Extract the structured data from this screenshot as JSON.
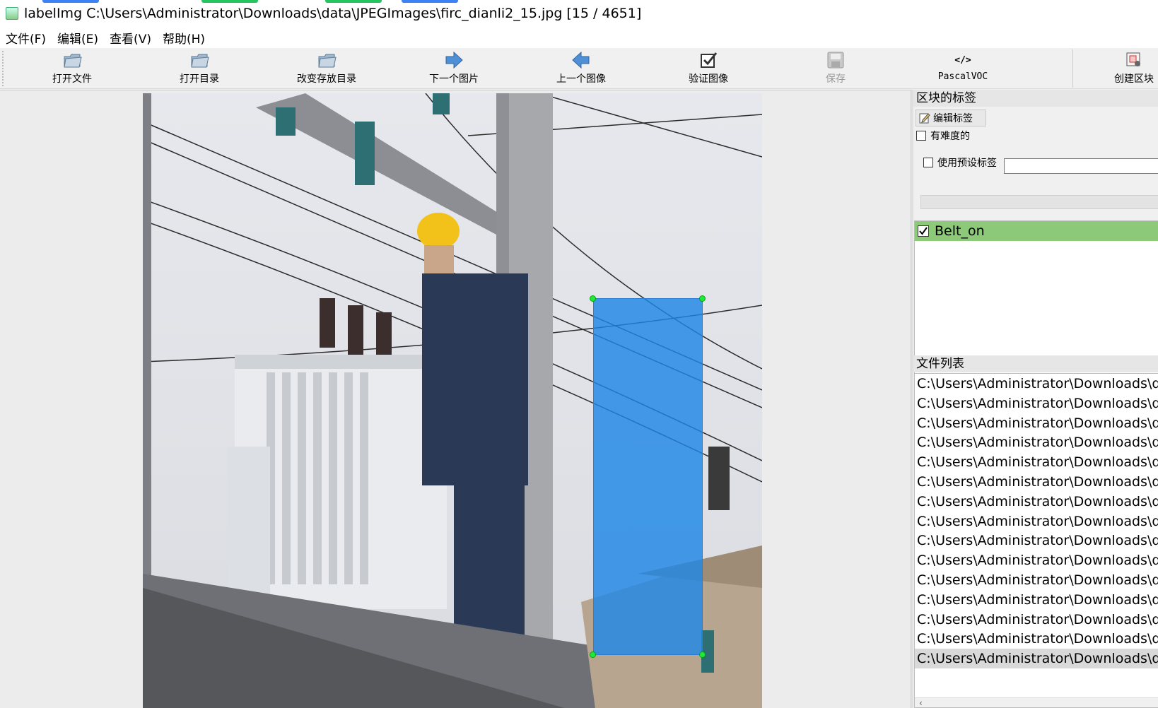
{
  "window": {
    "title": "labelImg C:\\Users\\Administrator\\Downloads\\data\\JPEGImages\\firc_dianli2_15.jpg [15 / 4651]"
  },
  "menu": [
    "文件(F)",
    "编辑(E)",
    "查看(V)",
    "帮助(H)"
  ],
  "toolbar": {
    "open_file": "打开文件",
    "open_dir": "打开目录",
    "change_save_dir": "改变存放目录",
    "next_image": "下一个图片",
    "prev_image": "上一个图像",
    "verify_image": "验证图像",
    "save": "保存",
    "format": "PascalVOC",
    "create_box": "创建区块",
    "format_icon_text": "</>"
  },
  "labels_panel": {
    "title": "区块的标签",
    "edit_label_button": "编辑标签",
    "difficult_label": "有难度的",
    "difficult_checked": false,
    "use_default_label": "使用预设标签",
    "use_default_checked": false,
    "default_label_value": "",
    "items": [
      {
        "label": "Belt_on",
        "checked": true,
        "color": "#8cca7a"
      }
    ]
  },
  "file_panel": {
    "title": "文件列表",
    "files": [
      "C:\\Users\\Administrator\\Downloads\\data",
      "C:\\Users\\Administrator\\Downloads\\data",
      "C:\\Users\\Administrator\\Downloads\\data",
      "C:\\Users\\Administrator\\Downloads\\data",
      "C:\\Users\\Administrator\\Downloads\\data",
      "C:\\Users\\Administrator\\Downloads\\data",
      "C:\\Users\\Administrator\\Downloads\\data",
      "C:\\Users\\Administrator\\Downloads\\data",
      "C:\\Users\\Administrator\\Downloads\\data",
      "C:\\Users\\Administrator\\Downloads\\data",
      "C:\\Users\\Administrator\\Downloads\\data",
      "C:\\Users\\Administrator\\Downloads\\data",
      "C:\\Users\\Administrator\\Downloads\\data",
      "C:\\Users\\Administrator\\Downloads\\data",
      "C:\\Users\\Administrator\\Downloads\\data"
    ],
    "selected_index": 14
  },
  "annotation": {
    "label": "Belt_on",
    "fill_color": "#1e88e5",
    "vertex_color": "#1eea3a"
  },
  "colors": {
    "toolbar_bg": "#f0f0f0",
    "label_highlight": "#8cca7a",
    "selection_bg": "#d9d9d9"
  }
}
